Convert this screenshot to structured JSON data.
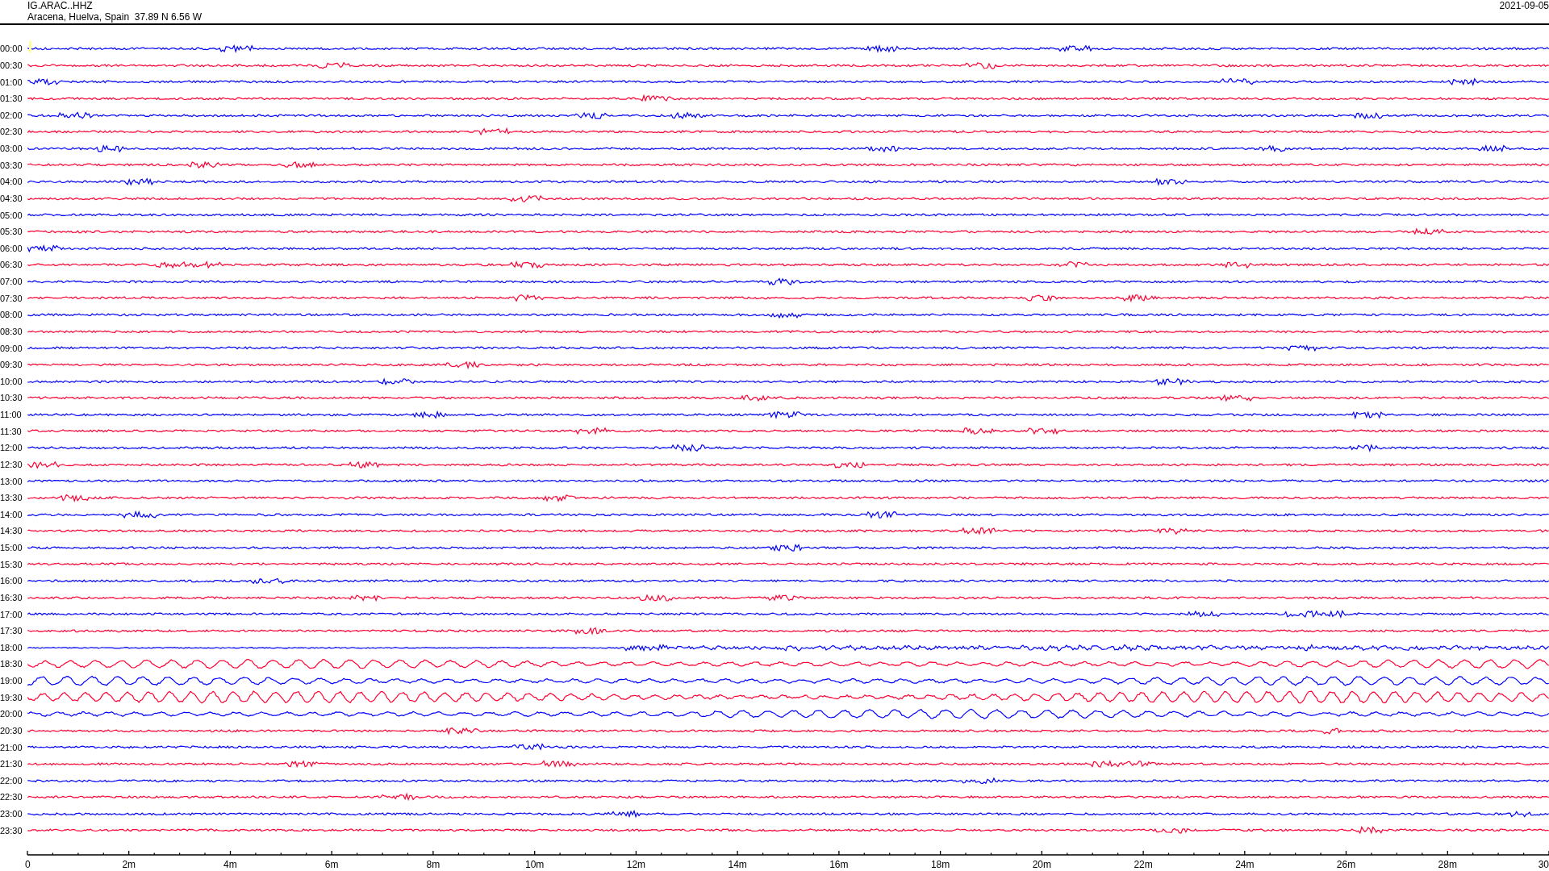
{
  "header": {
    "station": "IG.ARAC..HHZ",
    "location": "Aracena, Huelva, Spain  37.89 N 6.56 W",
    "date": "2021-09-05"
  },
  "traces": [
    {
      "time": "00:00",
      "color": "#0000ff",
      "kind": "quiet"
    },
    {
      "time": "00:30",
      "color": "#ff0033",
      "kind": "quiet"
    },
    {
      "time": "01:00",
      "color": "#0000ff",
      "kind": "quiet"
    },
    {
      "time": "01:30",
      "color": "#ff0033",
      "kind": "quiet"
    },
    {
      "time": "02:00",
      "color": "#0000ff",
      "kind": "quiet"
    },
    {
      "time": "02:30",
      "color": "#ff0033",
      "kind": "quiet"
    },
    {
      "time": "03:00",
      "color": "#0000ff",
      "kind": "quiet"
    },
    {
      "time": "03:30",
      "color": "#ff0033",
      "kind": "quiet"
    },
    {
      "time": "04:00",
      "color": "#0000ff",
      "kind": "quiet"
    },
    {
      "time": "04:30",
      "color": "#ff0033",
      "kind": "quiet"
    },
    {
      "time": "05:00",
      "color": "#0000ff",
      "kind": "quiet"
    },
    {
      "time": "05:30",
      "color": "#ff0033",
      "kind": "quiet"
    },
    {
      "time": "06:00",
      "color": "#0000ff",
      "kind": "quiet"
    },
    {
      "time": "06:30",
      "color": "#ff0033",
      "kind": "quiet"
    },
    {
      "time": "07:00",
      "color": "#0000ff",
      "kind": "quiet"
    },
    {
      "time": "07:30",
      "color": "#ff0033",
      "kind": "quiet"
    },
    {
      "time": "08:00",
      "color": "#0000ff",
      "kind": "quiet"
    },
    {
      "time": "08:30",
      "color": "#ff0033",
      "kind": "quiet"
    },
    {
      "time": "09:00",
      "color": "#0000ff",
      "kind": "quiet"
    },
    {
      "time": "09:30",
      "color": "#ff0033",
      "kind": "quiet"
    },
    {
      "time": "10:00",
      "color": "#0000ff",
      "kind": "quiet"
    },
    {
      "time": "10:30",
      "color": "#ff0033",
      "kind": "quiet"
    },
    {
      "time": "11:00",
      "color": "#0000ff",
      "kind": "quiet"
    },
    {
      "time": "11:30",
      "color": "#ff0033",
      "kind": "quiet"
    },
    {
      "time": "12:00",
      "color": "#0000ff",
      "kind": "quiet"
    },
    {
      "time": "12:30",
      "color": "#ff0033",
      "kind": "quiet"
    },
    {
      "time": "13:00",
      "color": "#0000ff",
      "kind": "quiet"
    },
    {
      "time": "13:30",
      "color": "#ff0033",
      "kind": "quiet"
    },
    {
      "time": "14:00",
      "color": "#0000ff",
      "kind": "quiet"
    },
    {
      "time": "14:30",
      "color": "#ff0033",
      "kind": "quiet"
    },
    {
      "time": "15:00",
      "color": "#0000ff",
      "kind": "quiet"
    },
    {
      "time": "15:30",
      "color": "#ff0033",
      "kind": "quiet"
    },
    {
      "time": "16:00",
      "color": "#0000ff",
      "kind": "quiet"
    },
    {
      "time": "16:30",
      "color": "#ff0033",
      "kind": "quiet"
    },
    {
      "time": "17:00",
      "color": "#0000ff",
      "kind": "quiet"
    },
    {
      "time": "17:30",
      "color": "#ff0033",
      "kind": "quiet"
    },
    {
      "time": "18:00",
      "color": "#0000ff",
      "kind": "onset"
    },
    {
      "time": "18:30",
      "color": "#ff0033",
      "kind": "swell"
    },
    {
      "time": "19:00",
      "color": "#0000ff",
      "kind": "swell"
    },
    {
      "time": "19:30",
      "color": "#ff0033",
      "kind": "strong"
    },
    {
      "time": "20:00",
      "color": "#0000ff",
      "kind": "swell"
    },
    {
      "time": "20:30",
      "color": "#ff0033",
      "kind": "quiet"
    },
    {
      "time": "21:00",
      "color": "#0000ff",
      "kind": "quiet"
    },
    {
      "time": "21:30",
      "color": "#ff0033",
      "kind": "quiet"
    },
    {
      "time": "22:00",
      "color": "#0000ff",
      "kind": "quiet"
    },
    {
      "time": "22:30",
      "color": "#ff0033",
      "kind": "quiet"
    },
    {
      "time": "23:00",
      "color": "#0000ff",
      "kind": "quiet"
    },
    {
      "time": "23:30",
      "color": "#ff0033",
      "kind": "quiet"
    }
  ],
  "axis": {
    "labels": [
      "0",
      "2m",
      "4m",
      "6m",
      "8m",
      "10m",
      "12m",
      "14m",
      "16m",
      "18m",
      "20m",
      "22m",
      "24m",
      "26m",
      "28m",
      "30"
    ]
  }
}
